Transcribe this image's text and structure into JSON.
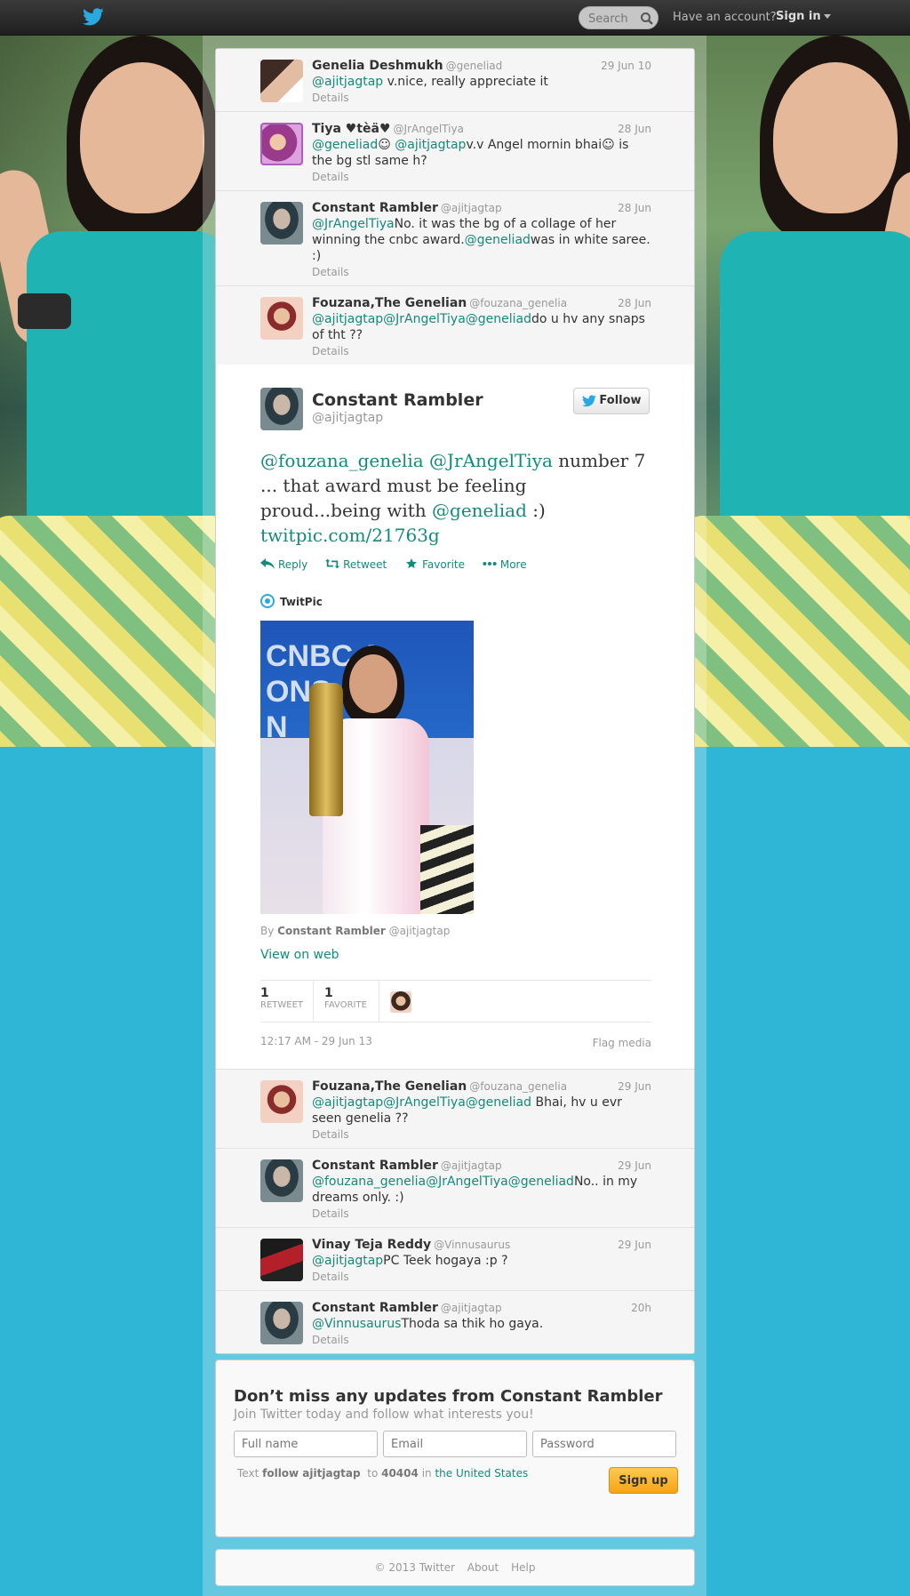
{
  "topbar": {
    "search_placeholder": "Search",
    "have_account": "Have an account?",
    "signin": "Sign in"
  },
  "timeline_before": [
    {
      "name": "Genelia Deshmukh",
      "handle": "@geneliad",
      "time": "29 Jun 10",
      "parts": [
        {
          "t": "@ajitjagtap",
          "l": true
        },
        {
          "t": " v.nice, really appreciate it",
          "l": false
        }
      ],
      "details": "Details",
      "avatar": "av-gen"
    },
    {
      "name": "Tiya ♥tèä♥",
      "handle": "@JrAngelTiya",
      "time": "28 Jun",
      "parts": [
        {
          "t": "@geneliad",
          "l": true
        },
        {
          "t": "☺ ",
          "l": false
        },
        {
          "t": "@ajitjagtap",
          "l": true
        },
        {
          "t": "v.v Angel mornin bhai☺ is the bg stl same h?",
          "l": false
        }
      ],
      "details": "Details",
      "avatar": "av-tiya"
    },
    {
      "name": "Constant Rambler",
      "handle": "@ajitjagtap",
      "time": "28 Jun",
      "parts": [
        {
          "t": "@JrAngelTiya",
          "l": true
        },
        {
          "t": "No. it was the bg of a collage of her winning the cnbc award.",
          "l": false
        },
        {
          "t": "@geneliad",
          "l": true
        },
        {
          "t": "was in white saree. :)",
          "l": false
        }
      ],
      "details": "Details",
      "avatar": "av-cr"
    },
    {
      "name": "Fouzana,The Genelian",
      "handle": "@fouzana_genelia",
      "time": "28 Jun",
      "parts": [
        {
          "t": "@ajitjagtap",
          "l": true
        },
        {
          "t": "@JrAngelTiya",
          "l": true
        },
        {
          "t": "@geneliad",
          "l": true
        },
        {
          "t": "do u hv any snaps of tht ??",
          "l": false
        }
      ],
      "details": "Details",
      "avatar": "av-fou"
    }
  ],
  "perma": {
    "name": "Constant Rambler",
    "handle": "@ajitjagtap",
    "follow": "Follow",
    "parts": [
      {
        "t": "@fouzana_genelia",
        "l": true
      },
      {
        "t": " ",
        "l": false
      },
      {
        "t": "@JrAngelTiya",
        "l": true
      },
      {
        "t": " number 7 ... that award must be feeling proud...being with ",
        "l": false
      },
      {
        "t": "@geneliad",
        "l": true
      },
      {
        "t": " :) ",
        "l": false
      },
      {
        "t": "twitpic.com/21763g",
        "l": true
      }
    ],
    "actions": {
      "reply": "Reply",
      "retweet": "Retweet",
      "favorite": "Favorite",
      "more": "More"
    },
    "media_source": "TwitPic",
    "media_backdrop": "CNBC A\nONS\nN",
    "by_prefix": "By",
    "by_name": "Constant Rambler",
    "by_handle": "@ajitjagtap",
    "view_on_web": "View on web",
    "retweets": {
      "count": "1",
      "label": "RETWEET"
    },
    "favorites": {
      "count": "1",
      "label": "FAVORITE"
    },
    "timestamp": "12:17 AM - 29 Jun 13",
    "flag": "Flag media"
  },
  "timeline_after": [
    {
      "name": "Fouzana,The Genelian",
      "handle": "@fouzana_genelia",
      "time": "29 Jun",
      "parts": [
        {
          "t": "@ajitjagtap",
          "l": true
        },
        {
          "t": "@JrAngelTiya",
          "l": true
        },
        {
          "t": "@geneliad",
          "l": true
        },
        {
          "t": " Bhai, hv u evr seen genelia ??",
          "l": false
        }
      ],
      "details": "Details",
      "avatar": "av-fou"
    },
    {
      "name": "Constant Rambler",
      "handle": "@ajitjagtap",
      "time": "29 Jun",
      "parts": [
        {
          "t": "@fouzana_genelia",
          "l": true
        },
        {
          "t": "@JrAngelTiya",
          "l": true
        },
        {
          "t": "@geneliad",
          "l": true
        },
        {
          "t": "No.. in my dreams only. :)",
          "l": false
        }
      ],
      "details": "Details",
      "avatar": "av-cr"
    },
    {
      "name": "Vinay Teja Reddy",
      "handle": "@Vinnusaurus",
      "time": "29 Jun",
      "parts": [
        {
          "t": "@ajitjagtap",
          "l": true
        },
        {
          "t": "PC Teek hogaya :p ?",
          "l": false
        }
      ],
      "details": "Details",
      "avatar": "av-vin"
    },
    {
      "name": "Constant Rambler",
      "handle": "@ajitjagtap",
      "time": "20h",
      "parts": [
        {
          "t": "@Vinnusaurus",
          "l": true
        },
        {
          "t": "Thoda sa thik ho gaya.",
          "l": false
        }
      ],
      "details": "Details",
      "avatar": "av-cr"
    }
  ],
  "signup": {
    "title": "Don’t miss any updates from Constant Rambler",
    "subtitle": "Join Twitter today and follow what interests you!",
    "fullname_placeholder": "Full name",
    "email_placeholder": "Email",
    "password_placeholder": "Password",
    "sms_text": "Text",
    "sms_cmd": "follow ajitjagtap",
    "sms_to": "to",
    "sms_number": "40404",
    "sms_in": "in",
    "sms_country": "the United States",
    "button": "Sign up"
  },
  "footer": {
    "copyright": "© 2013 Twitter",
    "about": "About",
    "help": "Help"
  },
  "colors": {
    "link": "#138a7a",
    "background": "#2fb6d6",
    "signup_button": "#f8a415"
  }
}
